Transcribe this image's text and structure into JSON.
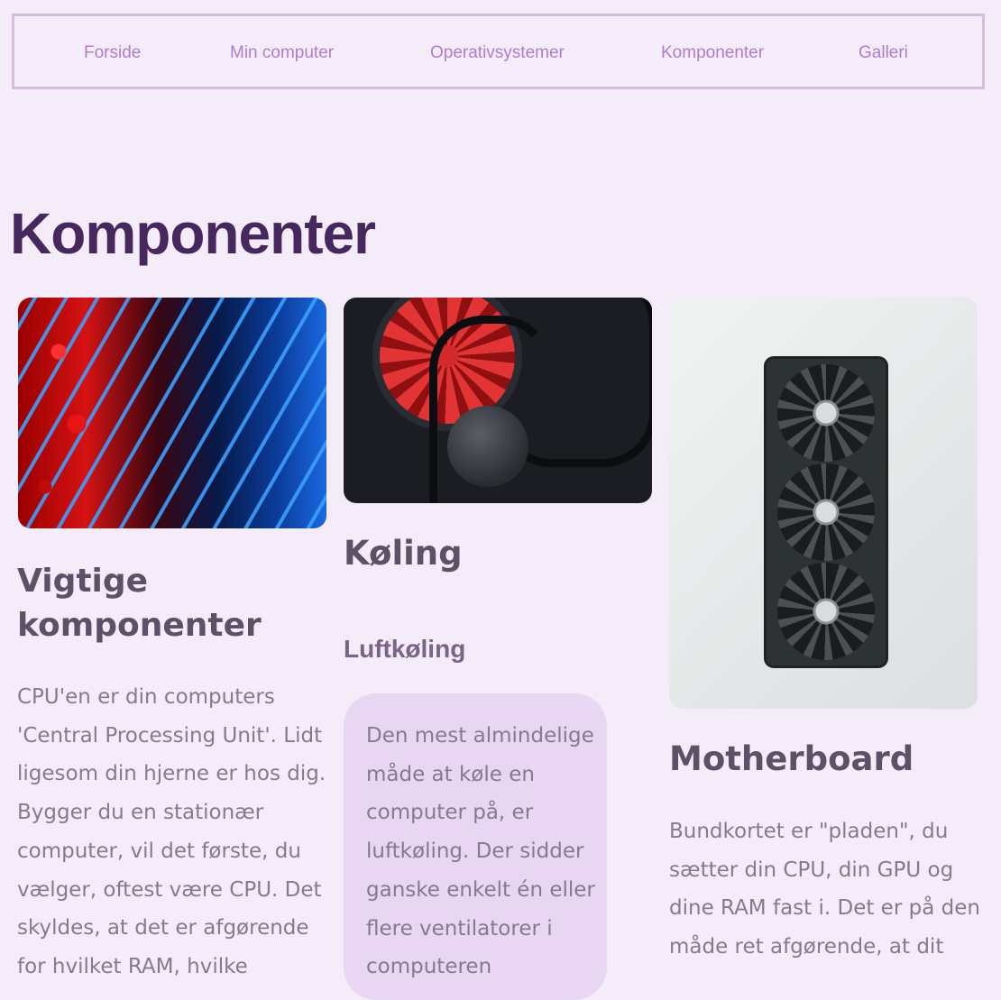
{
  "nav": {
    "items": [
      "Forside",
      "Min computer",
      "Operativsystemer",
      "Komponenter",
      "Galleri"
    ]
  },
  "page": {
    "title": "Komponenter"
  },
  "cards": {
    "cpu": {
      "heading": "Vigtige komponenter",
      "text": "CPU'en er din computers 'Central Processing Unit'. Lidt ligesom din hjerne er hos dig. Bygger du en stationær computer, vil det første, du vælger, oftest være CPU. Det skyldes, at det er afgørende for hvilket RAM, hvilke"
    },
    "cooling": {
      "heading": "Køling",
      "subheading": "Luftkøling",
      "text": "Den mest almindelige måde at køle en computer på, er luftkøling. Der sidder ganske enkelt én eller flere ventilatorer i computeren"
    },
    "motherboard": {
      "heading": "Motherboard",
      "text": "Bundkortet er \"pladen\", du sætter din CPU, din GPU og dine RAM fast i. Det er på den måde ret afgørende, at dit"
    }
  },
  "colors": {
    "background": "#f4ecf8",
    "nav_link": "#b07ccf",
    "title": "#47285e",
    "callout": "#e8d6f3"
  },
  "icons": [
    "cpu-circuit-image",
    "cpu-cooler-image",
    "graphics-card-image"
  ]
}
